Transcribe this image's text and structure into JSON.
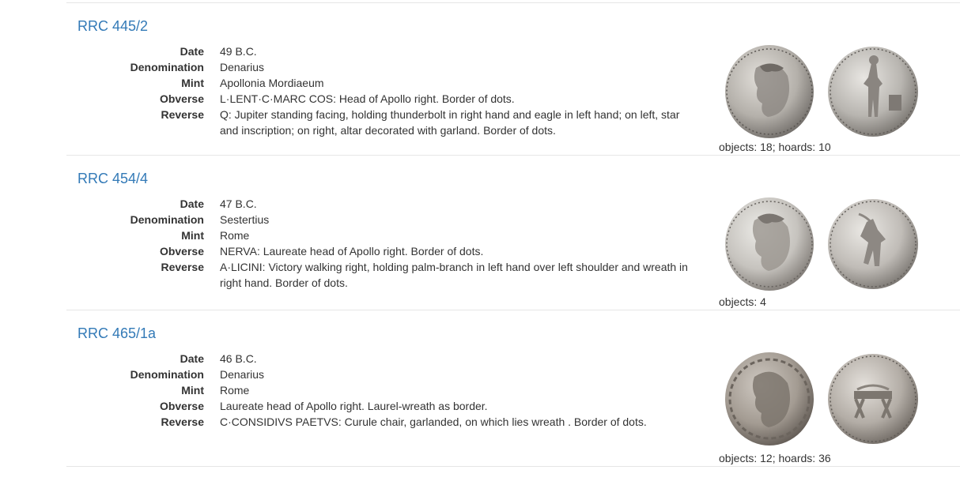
{
  "entries": [
    {
      "id": "RRC 445/2",
      "fields": {
        "date_label": "Date",
        "date": "49 B.C.",
        "denomination_label": "Denomination",
        "denomination": "Denarius",
        "mint_label": "Mint",
        "mint": "Apollonia Mordiaeum",
        "obverse_label": "Obverse",
        "obverse": "L·LENT·C·MARC COS: Head of Apollo right. Border of dots.",
        "reverse_label": "Reverse",
        "reverse": "Q: Jupiter standing facing, holding thunderbolt in right hand and eagle in left hand; on left, star and inscription; on right, altar decorated with garland. Border of dots."
      },
      "counts": "objects: 18; hoards: 10",
      "colors": {
        "coin": "#b4b0aa",
        "edge": "#6e6a66"
      }
    },
    {
      "id": "RRC 454/4",
      "fields": {
        "date_label": "Date",
        "date": "47 B.C.",
        "denomination_label": "Denomination",
        "denomination": "Sestertius",
        "mint_label": "Mint",
        "mint": "Rome",
        "obverse_label": "Obverse",
        "obverse": "NERVA: Laureate head of Apollo right. Border of dots.",
        "reverse_label": "Reverse",
        "reverse": "A·LICINI: Victory walking right, holding palm-branch in left hand over left shoulder and wreath in right hand. Border of dots."
      },
      "counts": "objects: 4",
      "colors": {
        "coin": "#c6c3be",
        "edge": "#7d7873"
      }
    },
    {
      "id": "RRC 465/1a",
      "fields": {
        "date_label": "Date",
        "date": "46 B.C.",
        "denomination_label": "Denomination",
        "denomination": "Denarius",
        "mint_label": "Mint",
        "mint": "Rome",
        "obverse_label": "Obverse",
        "obverse": "Laureate head of Apollo right. Laurel-wreath as border.",
        "reverse_label": "Reverse",
        "reverse": "C·CONSIDIVS PAETVS: Curule chair, garlanded, on which lies wreath . Border of dots."
      },
      "counts": "objects: 12; hoards: 36",
      "colors": {
        "coin": "#a39b92",
        "edge": "#5f5852"
      }
    }
  ],
  "theme": {
    "link": "#337ab7",
    "divider": "#e6e6e6",
    "text": "#333333"
  }
}
